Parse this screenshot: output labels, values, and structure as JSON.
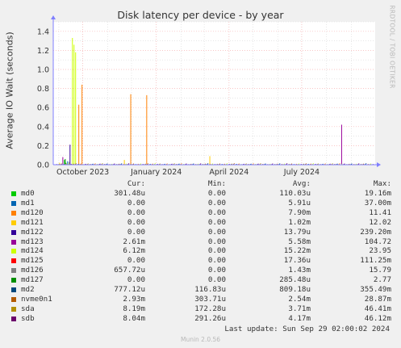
{
  "title": "Disk latency per device - by year",
  "watermark": "RRDTOOL / TOBI OETIKER",
  "footer": {
    "last_update": "Last update: Sun Sep 29 02:00:02 2024",
    "version": "Munin 2.0.56"
  },
  "legend_headers": {
    "cur": "Cur:",
    "min": "Min:",
    "avg": "Avg:",
    "max": "Max:"
  },
  "colors": {
    "background": "#f0f0f0",
    "plot_bg": "#ffffff",
    "grid_major": "#f7b3b3",
    "grid_minor": "#d8d8d8",
    "axis": "#7f7fff"
  },
  "chart_data": {
    "type": "line",
    "title": "Disk latency per device - by year",
    "xlabel": "",
    "ylabel": "Average IO Wait (seconds)",
    "ylim": [
      0,
      1.5
    ],
    "yticks": [
      0.0,
      0.2,
      0.4,
      0.6,
      0.8,
      1.0,
      1.2,
      1.4
    ],
    "ytick_labels": [
      "0.0",
      "0.2",
      "0.4",
      "0.6",
      "0.8",
      "1.0",
      "1.2",
      "1.4"
    ],
    "xlim": [
      "2023-08-25",
      "2024-10-01"
    ],
    "xticks": [
      {
        "date": "2023-10-01",
        "label": "October 2023"
      },
      {
        "date": "2024-01-01",
        "label": "January 2024"
      },
      {
        "date": "2024-04-01",
        "label": "April 2024"
      },
      {
        "date": "2024-07-01",
        "label": "July 2024"
      }
    ],
    "grid": true,
    "series": [
      {
        "name": "md0",
        "color": "#00cc00",
        "cur": "301.48u",
        "min": "0.00",
        "avg": "110.03u",
        "max": "19.16m",
        "points": [
          [
            "2023-09-08",
            0.05
          ],
          [
            "2023-09-10",
            0.02
          ]
        ]
      },
      {
        "name": "md1",
        "color": "#0066b3",
        "cur": "0.00",
        "min": "0.00",
        "avg": "5.91u",
        "max": "37.00m",
        "points": [
          [
            "2023-09-12",
            0.037
          ]
        ]
      },
      {
        "name": "md120",
        "color": "#ff8000",
        "cur": "0.00",
        "min": "0.00",
        "avg": "7.90m",
        "max": "11.41",
        "points": [
          [
            "2023-09-26",
            0.63
          ],
          [
            "2023-09-30",
            0.84
          ],
          [
            "2023-11-30",
            0.74
          ],
          [
            "2023-12-20",
            0.73
          ]
        ]
      },
      {
        "name": "md121",
        "color": "#ffcc00",
        "cur": "0.00",
        "min": "0.00",
        "avg": "1.02m",
        "max": "12.02",
        "points": [
          [
            "2023-09-02",
            0.02
          ],
          [
            "2023-11-22",
            0.05
          ],
          [
            "2024-03-08",
            0.09
          ]
        ]
      },
      {
        "name": "md122",
        "color": "#330099",
        "cur": "0.00",
        "min": "0.00",
        "avg": "13.79u",
        "max": "239.20m",
        "points": [
          [
            "2023-09-15",
            0.21
          ]
        ]
      },
      {
        "name": "md123",
        "color": "#990099",
        "cur": "2.61m",
        "min": "0.00",
        "avg": "5.58m",
        "max": "104.72",
        "points": [
          [
            "2023-09-06",
            0.08
          ],
          [
            "2024-08-20",
            0.42
          ]
        ]
      },
      {
        "name": "md124",
        "color": "#ccff00",
        "cur": "6.12m",
        "min": "0.00",
        "avg": "15.22m",
        "max": "23.95",
        "points": [
          [
            "2023-09-18",
            1.33
          ],
          [
            "2023-09-20",
            1.26
          ],
          [
            "2023-09-22",
            1.18
          ]
        ]
      },
      {
        "name": "md125",
        "color": "#ff0000",
        "cur": "0.00",
        "min": "0.00",
        "avg": "17.36u",
        "max": "111.25m",
        "points": []
      },
      {
        "name": "md126",
        "color": "#808080",
        "cur": "657.72u",
        "min": "0.00",
        "avg": "1.43m",
        "max": "15.79",
        "points": [
          [
            "2023-09-14",
            0.03
          ]
        ]
      },
      {
        "name": "md127",
        "color": "#008f00",
        "cur": "0.00",
        "min": "0.00",
        "avg": "285.48u",
        "max": "2.77",
        "points": [
          [
            "2023-09-09",
            0.06
          ]
        ]
      },
      {
        "name": "md2",
        "color": "#00487d",
        "cur": "777.12u",
        "min": "116.83u",
        "avg": "809.18u",
        "max": "355.49m",
        "points": []
      },
      {
        "name": "nvme0n1",
        "color": "#b35a00",
        "cur": "2.93m",
        "min": "303.71u",
        "avg": "2.54m",
        "max": "28.87m",
        "points": []
      },
      {
        "name": "sda",
        "color": "#b38f00",
        "cur": "8.19m",
        "min": "172.28u",
        "avg": "3.71m",
        "max": "46.41m",
        "points": []
      },
      {
        "name": "sdb",
        "color": "#6b006b",
        "cur": "8.04m",
        "min": "291.26u",
        "avg": "4.17m",
        "max": "46.12m",
        "points": []
      }
    ]
  }
}
